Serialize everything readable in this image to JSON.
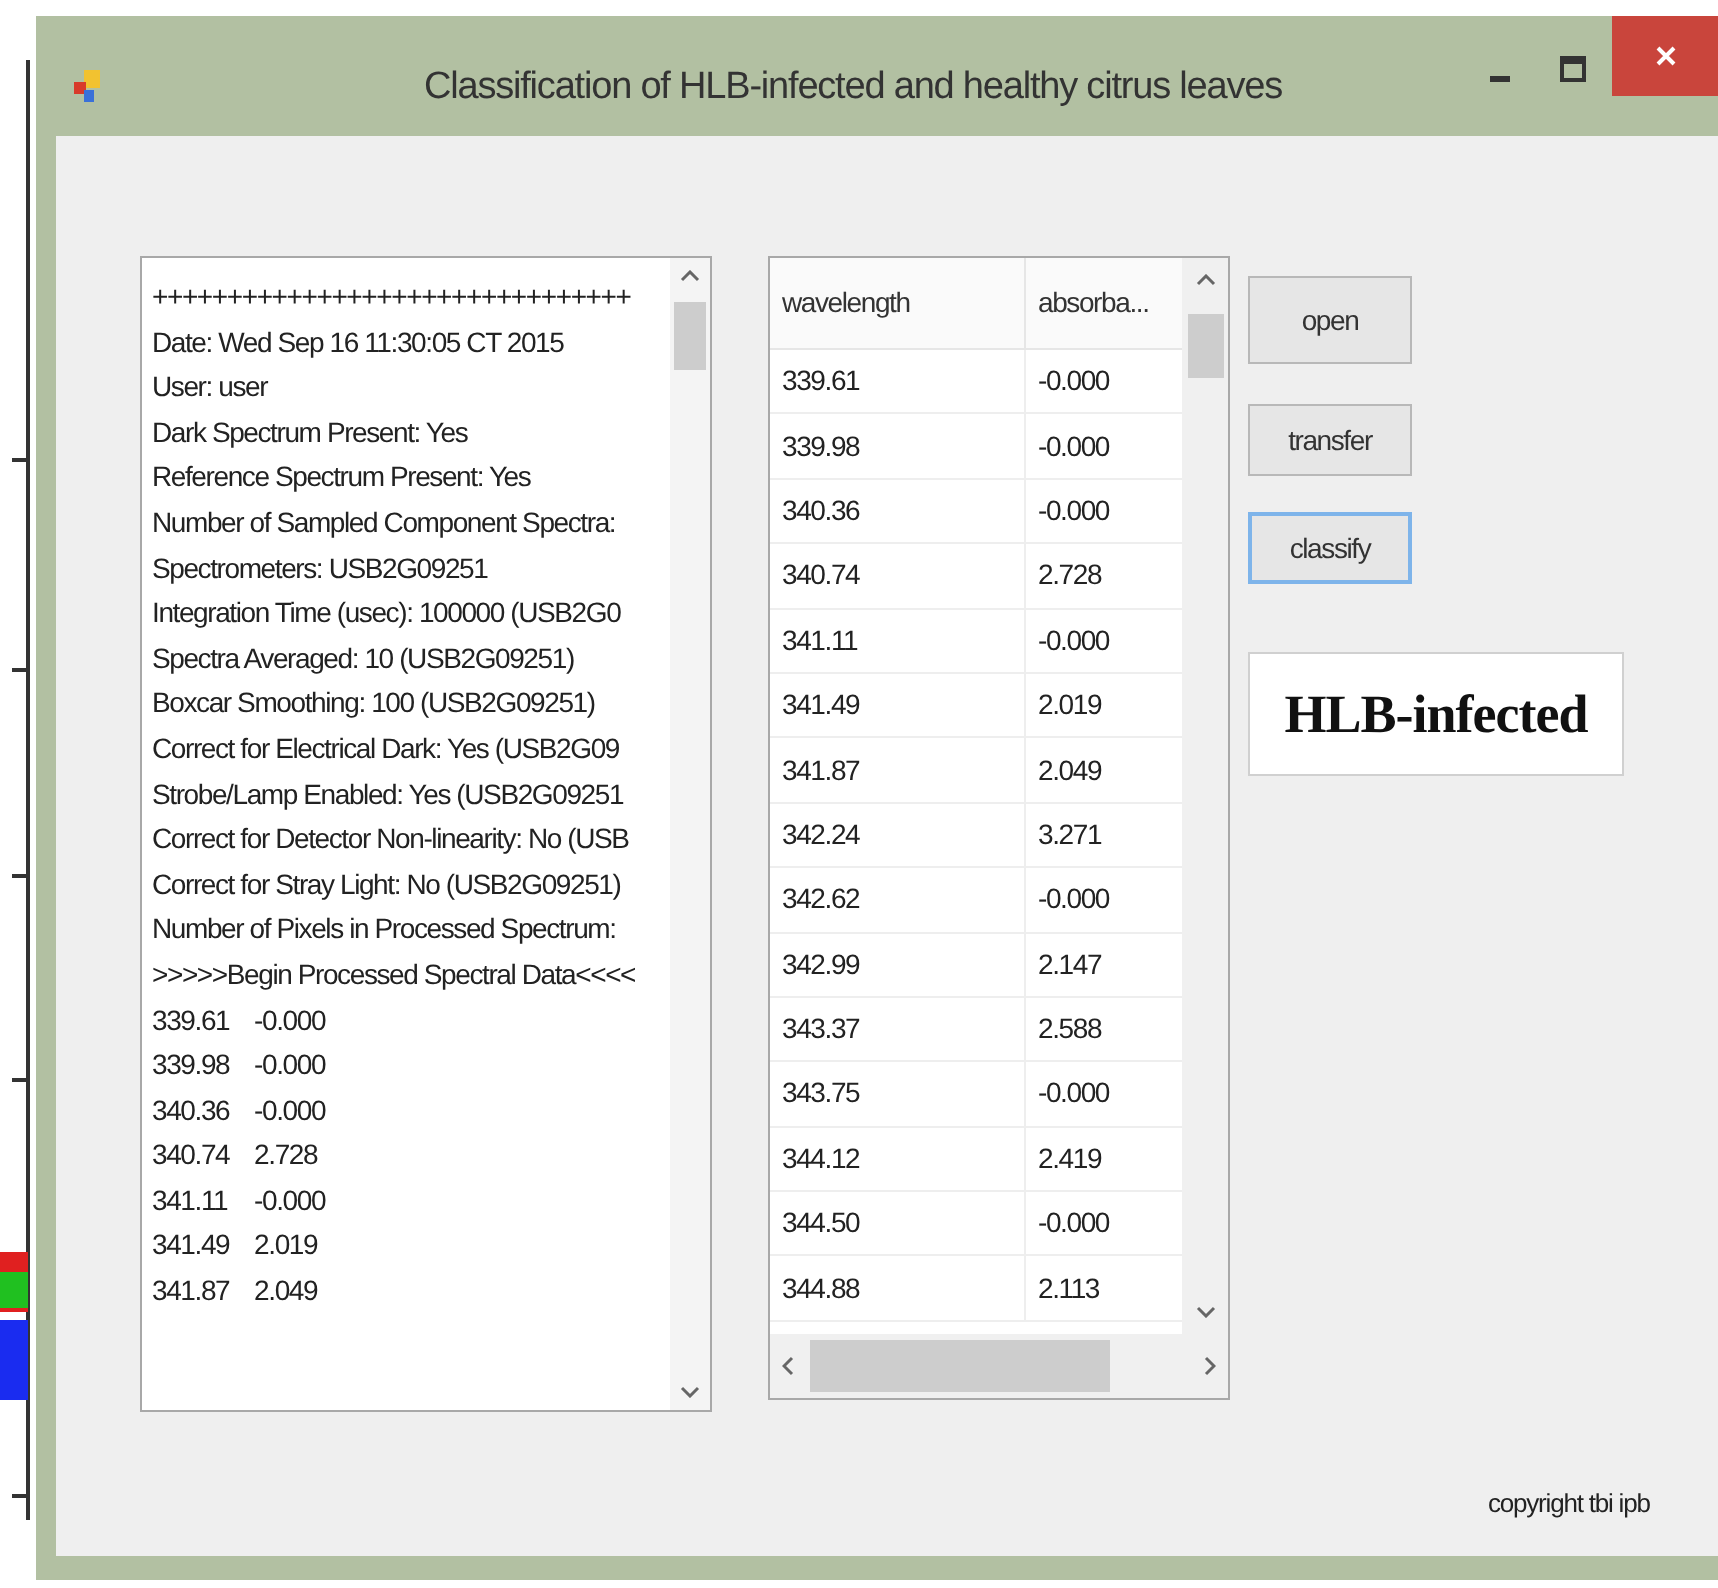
{
  "window": {
    "title": "Classification of HLB-infected and healthy citrus leaves"
  },
  "text_box": {
    "lines": [
      "++++++++++++++++++++++++++++++++",
      "Date: Wed Sep 16 11:30:05 CT 2015",
      "User: user",
      "Dark Spectrum Present: Yes",
      "Reference Spectrum Present: Yes",
      "Number of Sampled Component Spectra:",
      "Spectrometers: USB2G09251",
      "Integration Time (usec): 100000 (USB2G0",
      "Spectra Averaged: 10 (USB2G09251)",
      "Boxcar Smoothing: 100 (USB2G09251)",
      "Correct for Electrical Dark: Yes (USB2G09",
      "Strobe/Lamp Enabled: Yes (USB2G09251",
      "Correct for Detector Non-linearity: No (USB",
      "Correct for Stray Light: No (USB2G09251)",
      "Number of Pixels in Processed Spectrum:",
      ">>>>>Begin Processed Spectral Data<<<<",
      "339.61\t-0.000",
      "339.98\t-0.000",
      "340.36\t-0.000",
      "340.74\t2.728",
      "341.11\t-0.000",
      "341.49\t2.019",
      "341.87\t2.049"
    ]
  },
  "grid": {
    "columns": [
      "wavelength",
      "absorba..."
    ],
    "rows": [
      [
        "339.61",
        "-0.000"
      ],
      [
        "339.98",
        "-0.000"
      ],
      [
        "340.36",
        "-0.000"
      ],
      [
        "340.74",
        "2.728"
      ],
      [
        "341.11",
        "-0.000"
      ],
      [
        "341.49",
        "2.019"
      ],
      [
        "341.87",
        "2.049"
      ],
      [
        "342.24",
        "3.271"
      ],
      [
        "342.62",
        "-0.000"
      ],
      [
        "342.99",
        "2.147"
      ],
      [
        "343.37",
        "2.588"
      ],
      [
        "343.75",
        "-0.000"
      ],
      [
        "344.12",
        "2.419"
      ],
      [
        "344.50",
        "-0.000"
      ],
      [
        "344.88",
        "2.113"
      ]
    ]
  },
  "buttons": [
    {
      "label": "open",
      "focused": false
    },
    {
      "label": "transfer",
      "focused": false
    },
    {
      "label": "classify",
      "focused": true
    }
  ],
  "result": "HLB-infected",
  "footer": "copyright tbi ipb"
}
